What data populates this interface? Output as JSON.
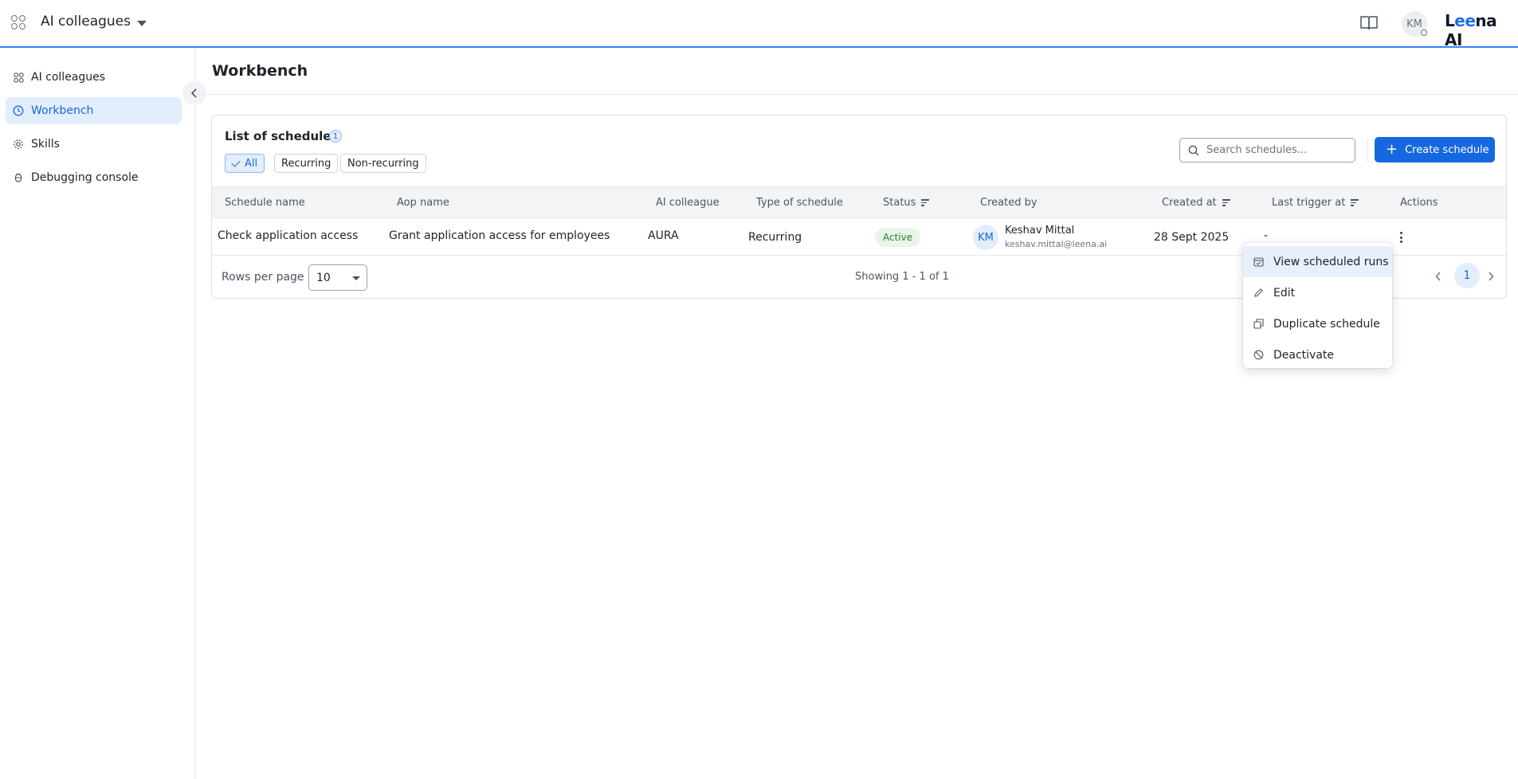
{
  "topbar": {
    "app_title": "AI colleagues",
    "avatar_initials": "KM",
    "brand": {
      "prefix": "L",
      "highlight": "ee",
      "suffix": "na AI"
    }
  },
  "sidebar": {
    "items": [
      {
        "label": "AI colleagues",
        "icon": "colleagues-grid-icon",
        "active": false
      },
      {
        "label": "Workbench",
        "icon": "clock-icon",
        "active": true
      },
      {
        "label": "Skills",
        "icon": "gear-icon",
        "active": false
      },
      {
        "label": "Debugging console",
        "icon": "bug-icon",
        "active": false
      }
    ]
  },
  "page": {
    "title": "Workbench"
  },
  "schedules": {
    "list_title": "List of schedules",
    "count": "1",
    "filters": [
      "All",
      "Recurring",
      "Non-recurring"
    ],
    "active_filter": "All",
    "search_placeholder": "Search schedules...",
    "create_label": "Create schedule",
    "columns": [
      "Schedule name",
      "Aop name",
      "AI colleague",
      "Type of schedule",
      "Status",
      "Created by",
      "Created at",
      "Last trigger at",
      "Actions"
    ],
    "rows": [
      {
        "schedule_name": "Check application access",
        "aop_name": "Grant application access for employees",
        "ai_colleague": "AURA",
        "type": "Recurring",
        "status": "Active",
        "creator_initials": "KM",
        "creator_name": "Keshav Mittal",
        "creator_email": "keshav.mittal@leena.ai",
        "created_at": "28 Sept 2025",
        "last_trigger": "-"
      }
    ],
    "footer": {
      "rows_per_page_label": "Rows per page",
      "rows_per_page_value": "10",
      "showing": "Showing 1 - 1 of 1",
      "current_page": "1"
    }
  },
  "actions_menu": {
    "items": [
      {
        "label": "View scheduled runs",
        "icon": "calendar-check-icon"
      },
      {
        "label": "Edit",
        "icon": "pencil-icon"
      },
      {
        "label": "Duplicate schedule",
        "icon": "copy-icon"
      },
      {
        "label": "Deactivate",
        "icon": "ban-icon"
      }
    ]
  },
  "colors": {
    "accent": "#1668e0",
    "accent_light": "#e3eefc",
    "success_bg": "#e8f5e9",
    "success_text": "#2e7d32"
  }
}
